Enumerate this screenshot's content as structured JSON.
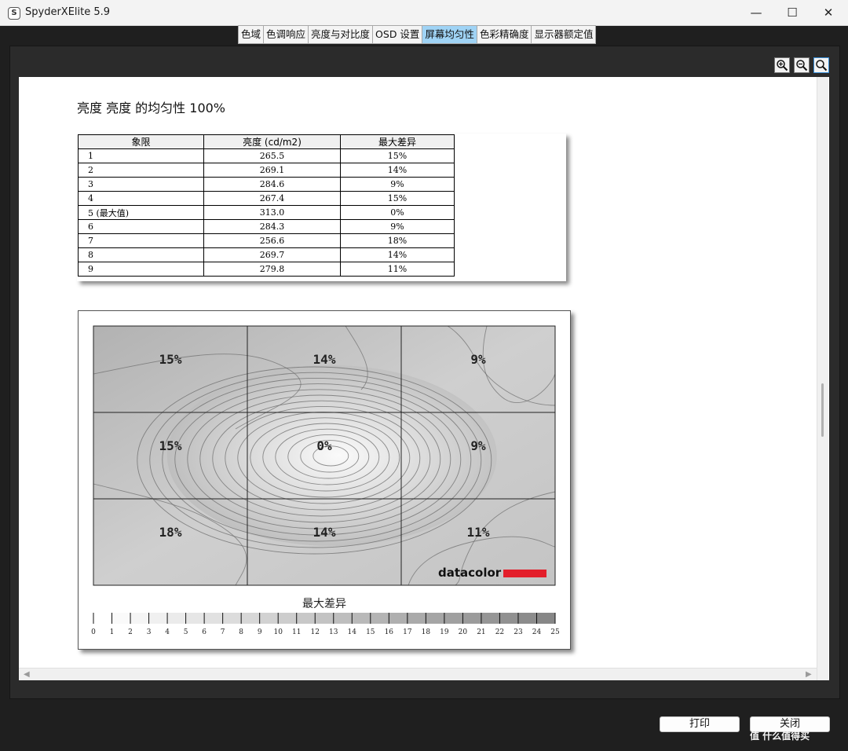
{
  "window": {
    "app_logo": "S",
    "title": "SpyderXElite 5.9",
    "minimize_glyph": "—",
    "maximize_glyph": "☐",
    "close_glyph": "✕"
  },
  "tabs": [
    {
      "label": "色域",
      "active": false
    },
    {
      "label": "色调响应",
      "active": false
    },
    {
      "label": "亮度与对比度",
      "active": false
    },
    {
      "label": "OSD 设置",
      "active": false
    },
    {
      "label": "屏幕均匀性",
      "active": true
    },
    {
      "label": "色彩精确度",
      "active": false
    },
    {
      "label": "显示器额定值",
      "active": false
    }
  ],
  "toolbar": {
    "zoom_in_icon": "zoom-in-icon",
    "zoom_out_icon": "zoom-out-icon",
    "zoom_fit_icon": "zoom-fit-icon"
  },
  "report": {
    "title": "亮度 亮度 的均匀性 100%",
    "table": {
      "headers": [
        "象限",
        "亮度 (cd/m2)",
        "最大差异"
      ],
      "rows": [
        [
          "1",
          "265.5",
          "15%"
        ],
        [
          "2",
          "269.1",
          "14%"
        ],
        [
          "3",
          "284.6",
          "9%"
        ],
        [
          "4",
          "267.4",
          "15%"
        ],
        [
          "5 (最大值)",
          "313.0",
          "0%"
        ],
        [
          "6",
          "284.3",
          "9%"
        ],
        [
          "7",
          "256.6",
          "18%"
        ],
        [
          "8",
          "269.7",
          "14%"
        ],
        [
          "9",
          "279.8",
          "11%"
        ]
      ]
    }
  },
  "chart_data": {
    "type": "heatmap",
    "title": "",
    "grid_rows": 3,
    "grid_cols": 3,
    "cells": [
      [
        "15%",
        "14%",
        "9%"
      ],
      [
        "15%",
        "0%",
        "9%"
      ],
      [
        "18%",
        "14%",
        "11%"
      ]
    ],
    "values": [
      [
        15,
        14,
        9
      ],
      [
        15,
        0,
        9
      ],
      [
        18,
        14,
        11
      ]
    ],
    "legend_title": "最大差异",
    "legend_ticks": [
      "0",
      "1",
      "2",
      "3",
      "4",
      "5",
      "6",
      "7",
      "8",
      "9",
      "10",
      "11",
      "12",
      "13",
      "14",
      "15",
      "16",
      "17",
      "18",
      "19",
      "20",
      "21",
      "22",
      "23",
      "24",
      "25"
    ],
    "legend_range": [
      0,
      25
    ],
    "logo": "datacolor",
    "logo_color": "#e31e2a"
  },
  "buttons": {
    "print": "打印",
    "close": "关闭"
  },
  "watermark": "值 什么值得买"
}
